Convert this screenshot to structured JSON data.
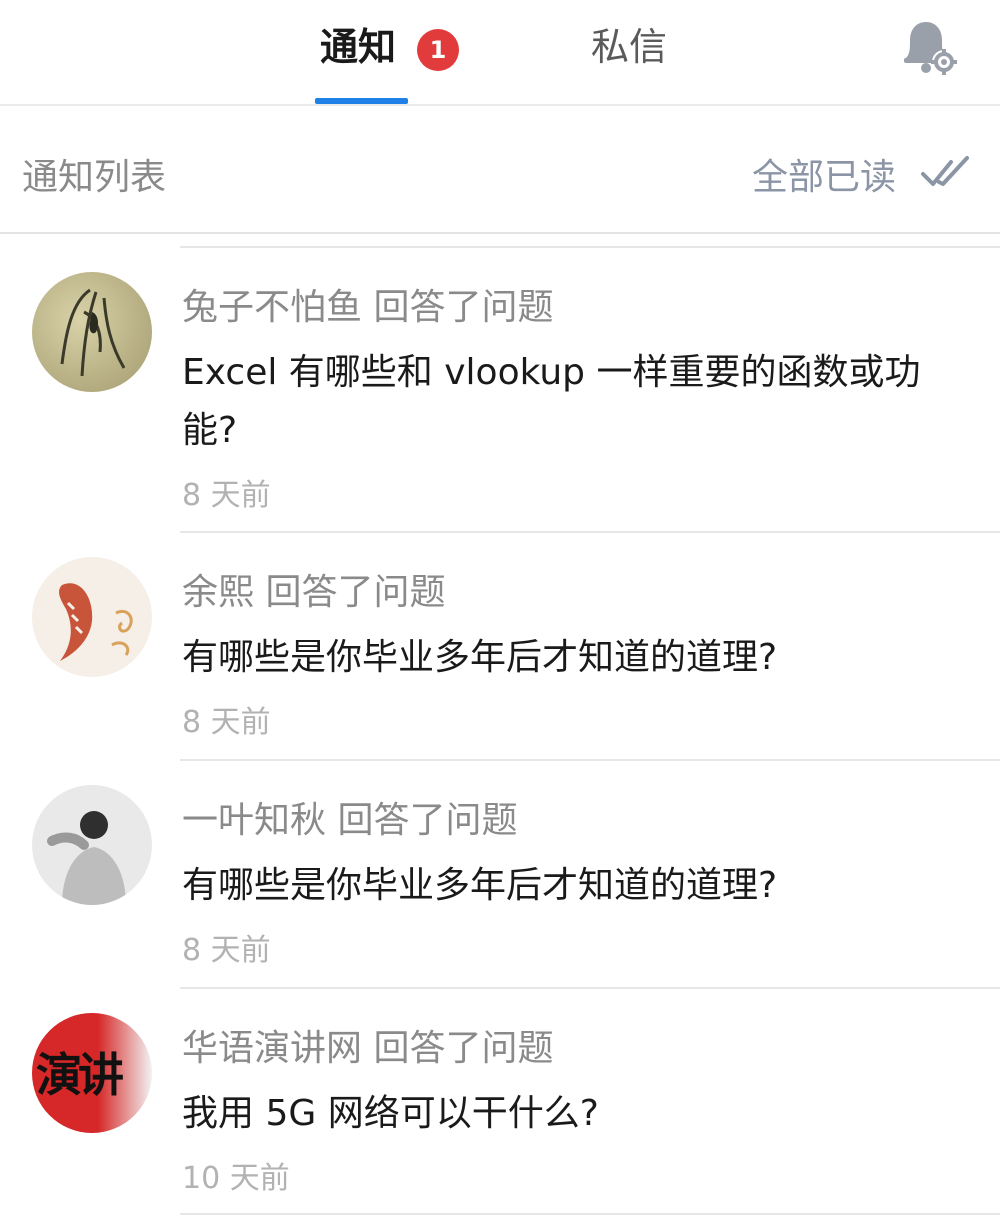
{
  "tabs": {
    "notify_label": "通知",
    "notify_badge": "1",
    "dm_label": "私信"
  },
  "icons": {
    "bell": "bell-settings-icon",
    "check": "double-check-icon"
  },
  "list": {
    "title": "通知列表",
    "mark_all_read": "全部已读"
  },
  "colors": {
    "accent": "#1f80e8",
    "badge": "#e23b3b"
  },
  "items": [
    {
      "actor": "兔子不怕鱼 回答了问题",
      "title": "Excel 有哪些和 vlookup 一样重要的函数或功能?",
      "time": "8 天前"
    },
    {
      "actor": "余熙 回答了问题",
      "title": "有哪些是你毕业多年后才知道的道理?",
      "time": "8 天前"
    },
    {
      "actor": "一叶知秋 回答了问题",
      "title": "有哪些是你毕业多年后才知道的道理?",
      "time": "8 天前"
    },
    {
      "actor": "华语演讲网 回答了问题",
      "title": "我用 5G 网络可以干什么?",
      "time": "10 天前",
      "avatar_text": "演讲"
    }
  ]
}
